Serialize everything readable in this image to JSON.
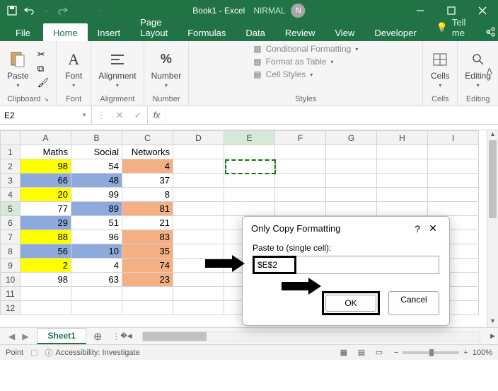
{
  "titlebar": {
    "doc": "Book1 - Excel",
    "user": "NIRMAL",
    "avatar": "N"
  },
  "tabs": {
    "file": "File",
    "home": "Home",
    "insert": "Insert",
    "page": "Page Layout",
    "formulas": "Formulas",
    "data": "Data",
    "review": "Review",
    "view": "View",
    "developer": "Developer",
    "tellme": "Tell me"
  },
  "ribbon": {
    "clipboard": {
      "paste": "Paste",
      "label": "Clipboard"
    },
    "font": {
      "btn": "Font",
      "label": "Font"
    },
    "align": {
      "btn": "Alignment",
      "label": "Alignment"
    },
    "number": {
      "btn": "Number",
      "label": "Number"
    },
    "styles": {
      "cond": "Conditional Formatting",
      "table": "Format as Table",
      "cell": "Cell Styles",
      "label": "Styles"
    },
    "cells": {
      "btn": "Cells",
      "label": "Cells"
    },
    "editing": {
      "btn": "Editing",
      "label": "Editing"
    }
  },
  "namebox": "E2",
  "sheet": {
    "cols": [
      "A",
      "B",
      "C",
      "D",
      "E",
      "F",
      "G",
      "H",
      "I"
    ],
    "headers": {
      "A": "Maths",
      "B": "Social",
      "C": "Networks"
    },
    "rows": [
      {
        "n": 1
      },
      {
        "n": 2,
        "A": 98,
        "B": 54,
        "C": 4,
        "Acls": "yellow",
        "Ccls": "peach"
      },
      {
        "n": 3,
        "A": 66,
        "B": 48,
        "C": 37,
        "Acls": "blue",
        "Bcls": "blue"
      },
      {
        "n": 4,
        "A": 20,
        "B": 99,
        "C": 8,
        "Acls": "yellow"
      },
      {
        "n": 5,
        "A": 77,
        "B": 89,
        "C": 81,
        "Bcls": "blue",
        "Ccls": "peach"
      },
      {
        "n": 6,
        "A": 29,
        "B": 51,
        "C": 21,
        "Acls": "blue"
      },
      {
        "n": 7,
        "A": 88,
        "B": 96,
        "C": 83,
        "Acls": "yellow",
        "Ccls": "peach"
      },
      {
        "n": 8,
        "A": 56,
        "B": 10,
        "C": 35,
        "Acls": "blue",
        "Bcls": "blue",
        "Ccls": "peach"
      },
      {
        "n": 9,
        "A": 2,
        "B": 4,
        "C": 74,
        "Acls": "yellow",
        "Ccls": "peach"
      },
      {
        "n": 10,
        "A": 98,
        "B": 63,
        "C": 23,
        "Ccls": "peach"
      },
      {
        "n": 11
      },
      {
        "n": 12
      }
    ],
    "tab": "Sheet1"
  },
  "dialog": {
    "title": "Only Copy Formatting",
    "label": "Paste to (single cell):",
    "value": "$E$2",
    "ok": "OK",
    "cancel": "Cancel"
  },
  "status": {
    "mode": "Point",
    "access": "Accessibility: Investigate",
    "zoom": "100%"
  }
}
